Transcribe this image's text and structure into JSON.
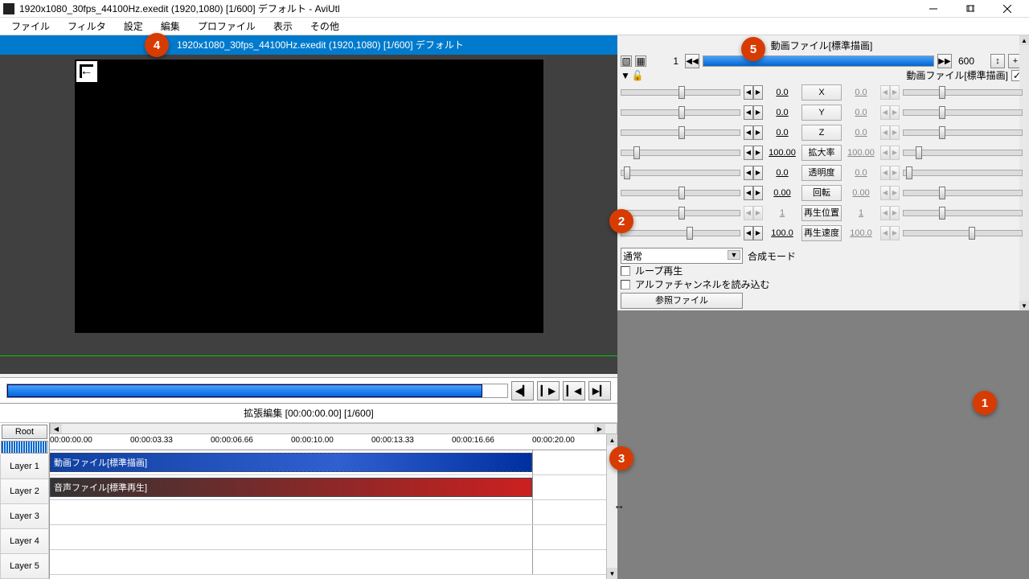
{
  "window": {
    "title": "1920x1080_30fps_44100Hz.exedit (1920,1080)  [1/600]  デフォルト - AviUtl"
  },
  "menu": [
    "ファイル",
    "フィルタ",
    "設定",
    "編集",
    "プロファイル",
    "表示",
    "その他"
  ],
  "preview": {
    "header": "1920x1080_30fps_44100Hz.exedit (1920,1080)  [1/600]  デフォルト"
  },
  "timeline": {
    "title": "拡張編集 [00:00:00.00] [1/600]",
    "root": "Root",
    "ticks": [
      "00:00:00.00",
      "00:00:03.33",
      "00:00:06.66",
      "00:00:10.00",
      "00:00:13.33",
      "00:00:16.66",
      "00:00:20.00"
    ],
    "layers": [
      "Layer 1",
      "Layer 2",
      "Layer 3",
      "Layer 4",
      "Layer 5"
    ],
    "clip_video": "動画ファイル[標準描画]",
    "clip_audio": "音声ファイル[標準再生]"
  },
  "props": {
    "title": "動画ファイル[標準描画]",
    "sub_title": "動画ファイル[標準描画]",
    "frame_start": "1",
    "frame_end": "600",
    "params": [
      {
        "name": "X",
        "l": "0.0",
        "r": "0.0",
        "tl": 48,
        "tr": 30
      },
      {
        "name": "Y",
        "l": "0.0",
        "r": "0.0",
        "tl": 48,
        "tr": 30
      },
      {
        "name": "Z",
        "l": "0.0",
        "r": "0.0",
        "tl": 48,
        "tr": 30
      },
      {
        "name": "拡大率",
        "l": "100.00",
        "r": "100.00",
        "tl": 10,
        "tr": 10
      },
      {
        "name": "透明度",
        "l": "0.0",
        "r": "0.0",
        "tl": 2,
        "tr": 2
      },
      {
        "name": "回転",
        "l": "0.00",
        "r": "0.00",
        "tl": 48,
        "tr": 30
      },
      {
        "name": "再生位置",
        "l": "1",
        "r": "1",
        "tl": 48,
        "tr": 30,
        "dis": true
      },
      {
        "name": "再生速度",
        "l": "100.0",
        "r": "100.0",
        "tl": 55,
        "tr": 55
      }
    ],
    "blend_label": "合成モード",
    "blend_value": "通常",
    "chk_loop": "ループ再生",
    "chk_alpha": "アルファチャンネルを読み込む",
    "ref_file": "参照ファイル"
  },
  "badges": {
    "b1": "1",
    "b2": "2",
    "b3": "3",
    "b4": "4",
    "b5": "5"
  }
}
